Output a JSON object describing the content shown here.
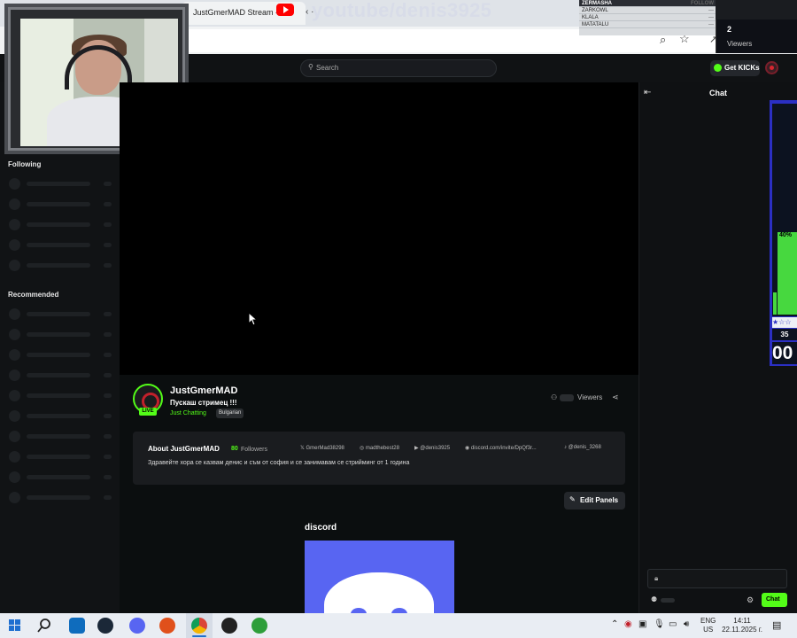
{
  "browser": {
    "tab_title": "JustGmerMAD Stream - W",
    "tab_nav": "‹ ·",
    "overlay_text": "youtube/denis3925",
    "leaderboard": [
      {
        "name": "ZERMASHA",
        "value": "FOLLOW"
      },
      {
        "name": "ZARKOWL",
        "value": "—"
      },
      {
        "name": "KLALA",
        "value": "—"
      },
      {
        "name": "MATATALU",
        "value": "—"
      }
    ],
    "viewers_count": "2",
    "viewers_label": "Viewers"
  },
  "header": {
    "search_placeholder": "Search",
    "get_kicks_label": "Get KICKs"
  },
  "sidebar": {
    "following_title": "Following",
    "recommended_title": "Recommended"
  },
  "stream": {
    "streamer_name": "JustGmerMAD",
    "live_label": "LIVE",
    "title": "Пускаш стримец !!!",
    "category": "Just Chatting",
    "language": "Bulgarian",
    "viewers_label": "Viewers"
  },
  "about": {
    "title": "About JustGmerMAD",
    "followers_count": "80",
    "followers_label": "Followers",
    "socials": [
      {
        "icon": "x-icon",
        "glyph": "𝕏",
        "label": "GmerMad38298"
      },
      {
        "icon": "instagram-icon",
        "glyph": "◎",
        "label": "madthebest28"
      },
      {
        "icon": "youtube-icon",
        "glyph": "▶",
        "label": "@denis3925"
      },
      {
        "icon": "discord-icon",
        "glyph": "◉",
        "label": "discord.com/invite/DpQf3r..."
      },
      {
        "icon": "tiktok-icon",
        "glyph": "♪",
        "label": "@denis_3268"
      }
    ],
    "description": "Здравейте хора се казвам денис и съм от софия и се занимавам се стрийминг от 1 година"
  },
  "panels": {
    "edit_label": "Edit Panels",
    "panel_title": "discord"
  },
  "chat": {
    "title": "Chat",
    "send_label": "Chat"
  },
  "widget": {
    "percent": "40%",
    "stars": "★☆☆",
    "number": "35",
    "timer": "00"
  },
  "taskbar": {
    "lang_top": "ENG",
    "lang_bottom": "US",
    "time": "14:11",
    "date": "22.11.2025 г."
  },
  "colors": {
    "accent": "#53fc18",
    "background": "#0b0e0f",
    "discord": "#5865f2",
    "widget_frame": "#2b2fc4"
  }
}
